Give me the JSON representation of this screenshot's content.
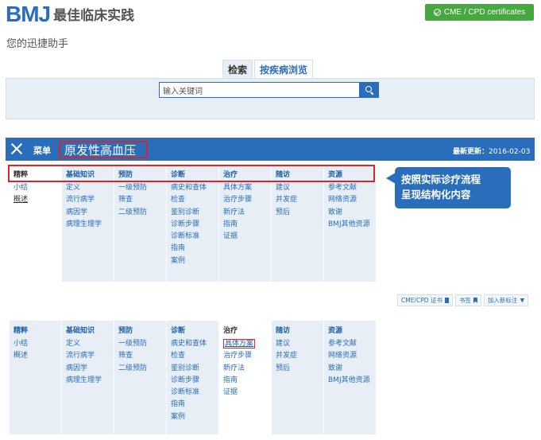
{
  "brand": {
    "logo": "BMJ",
    "name": "最佳临床实践",
    "tagline": "您的迅捷助手"
  },
  "cme_button": "CME / CPD certificates",
  "search": {
    "tabs": [
      "检索",
      "按疾病浏览"
    ],
    "placeholder": "输入关键词",
    "icon": "search-icon"
  },
  "topic": {
    "menu_label": "菜单",
    "title": "原发性高血压",
    "updated_label": "最新更新：",
    "updated_date": "2016-02-03"
  },
  "callout": [
    "按照实际诊疗流程",
    "呈现结构化内容"
  ],
  "toolbar": [
    "CME/CPD 证书",
    "书签",
    "加入新标注"
  ],
  "colors": {
    "brand": "#2a6ebb",
    "highlight": "#d9262c",
    "cme": "#45a940",
    "panel": "#e7eef5"
  },
  "nav": [
    {
      "head": "精粹",
      "items": [
        "小结",
        "概述"
      ]
    },
    {
      "head": "基础知识",
      "items": [
        "定义",
        "流行病学",
        "病因学",
        "病理生理学"
      ]
    },
    {
      "head": "预防",
      "items": [
        "一级预防",
        "筛查",
        "二级预防"
      ]
    },
    {
      "head": "诊断",
      "items": [
        "病史和查体",
        "检查",
        "鉴别诊断",
        "诊断步骤",
        "诊断标准",
        "指南",
        "案例"
      ]
    },
    {
      "head": "治疗",
      "items": [
        "具体方案",
        "治疗步骤",
        "新疗法",
        "指南",
        "证据"
      ]
    },
    {
      "head": "随访",
      "items": [
        "建议",
        "并发症",
        "预后"
      ]
    },
    {
      "head": "资源",
      "items": [
        "参考文献",
        "网络资源",
        "致谢",
        "BMJ其他资源"
      ]
    }
  ]
}
